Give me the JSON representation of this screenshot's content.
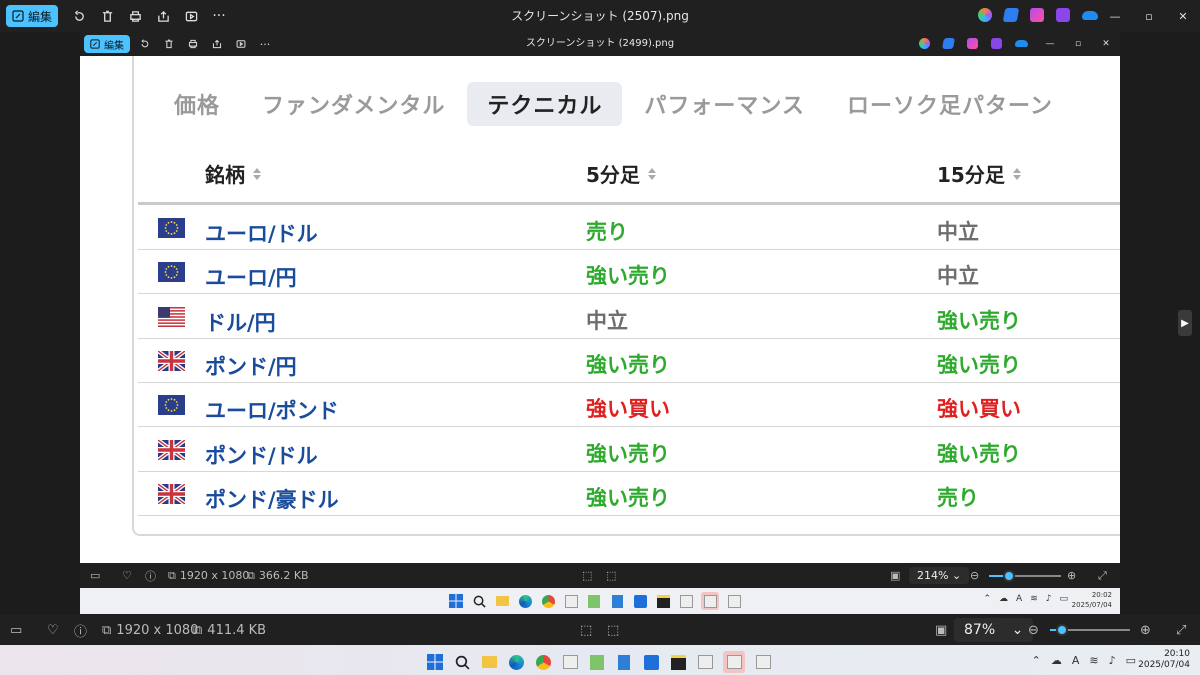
{
  "outer_window": {
    "title": "スクリーンショット (2507).png",
    "edit_label": "編集",
    "status": {
      "dimensions": "1920 x 1080",
      "file_size": "411.4 KB",
      "zoom": "87%",
      "zoom_fraction": 0.15
    },
    "clock": {
      "time": "20:10",
      "date": "2025/07/04"
    }
  },
  "inner_window": {
    "title": "スクリーンショット (2499).png",
    "edit_label": "編集",
    "status": {
      "dimensions": "1920 x 1080",
      "file_size": "366.2 KB",
      "zoom": "214%",
      "zoom_fraction": 0.28
    },
    "clock": {
      "time": "20:02",
      "date": "2025/07/04"
    }
  },
  "tabs": [
    {
      "label": "価格",
      "active": false
    },
    {
      "label": "ファンダメンタル",
      "active": false
    },
    {
      "label": "テクニカル",
      "active": true
    },
    {
      "label": "パフォーマンス",
      "active": false
    },
    {
      "label": "ローソク足パターン",
      "active": false
    }
  ],
  "table": {
    "headers": {
      "symbol": "銘柄",
      "m5": "5分足",
      "m15": "15分足"
    },
    "rows": [
      {
        "flag": "eu-flag-icon",
        "pair": "ユーロ/ドル",
        "m5": "売り",
        "m15": "中立"
      },
      {
        "flag": "eu-flag-icon",
        "pair": "ユーロ/円",
        "m5": "強い売り",
        "m15": "中立"
      },
      {
        "flag": "us-flag-icon",
        "pair": "ドル/円",
        "m5": "中立",
        "m15": "強い売り"
      },
      {
        "flag": "uk-flag-icon",
        "pair": "ポンド/円",
        "m5": "強い売り",
        "m15": "強い売り"
      },
      {
        "flag": "eu-flag-icon",
        "pair": "ユーロ/ポンド",
        "m5": "強い買い",
        "m15": "強い買い"
      },
      {
        "flag": "uk-flag-icon",
        "pair": "ポンド/ドル",
        "m5": "強い売り",
        "m15": "強い売り"
      },
      {
        "flag": "uk-flag-icon",
        "pair": "ポンド/豪ドル",
        "m5": "強い売り",
        "m15": "売り"
      }
    ]
  },
  "signal_colors": {
    "売り": "#2eaa2e",
    "強い売り": "#2eaa2e",
    "中立": "#6e6e6e",
    "強い買い": "#e01f1f"
  },
  "colors": {
    "accent": "#4cc2ff",
    "pair_link": "#1a4c9c"
  },
  "tray_input_label": "A"
}
